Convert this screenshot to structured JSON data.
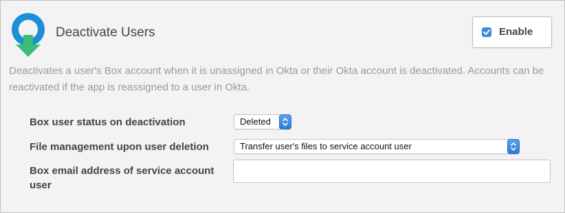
{
  "section": {
    "title": "Deactivate Users",
    "icon": "deactivate-user-icon",
    "icon_colors": {
      "ring": "#1e8ed6",
      "arrow": "#3bbd78"
    }
  },
  "enable_toggle": {
    "label": "Enable",
    "checked": true,
    "checkbox_color": "#3a88e0"
  },
  "description": "Deactivates a user's Box account when it is unassigned in Okta or their Okta account is deactivated. Accounts can be reactivated if the app is reassigned to a user in Okta.",
  "fields": {
    "status_on_deactivation": {
      "label": "Box user status on deactivation",
      "selected": "Deleted"
    },
    "file_management": {
      "label": "File management upon user deletion",
      "selected": "Transfer user's files to service account user"
    },
    "service_account_email": {
      "label": "Box email address of service account user",
      "value": "",
      "placeholder": ""
    }
  }
}
